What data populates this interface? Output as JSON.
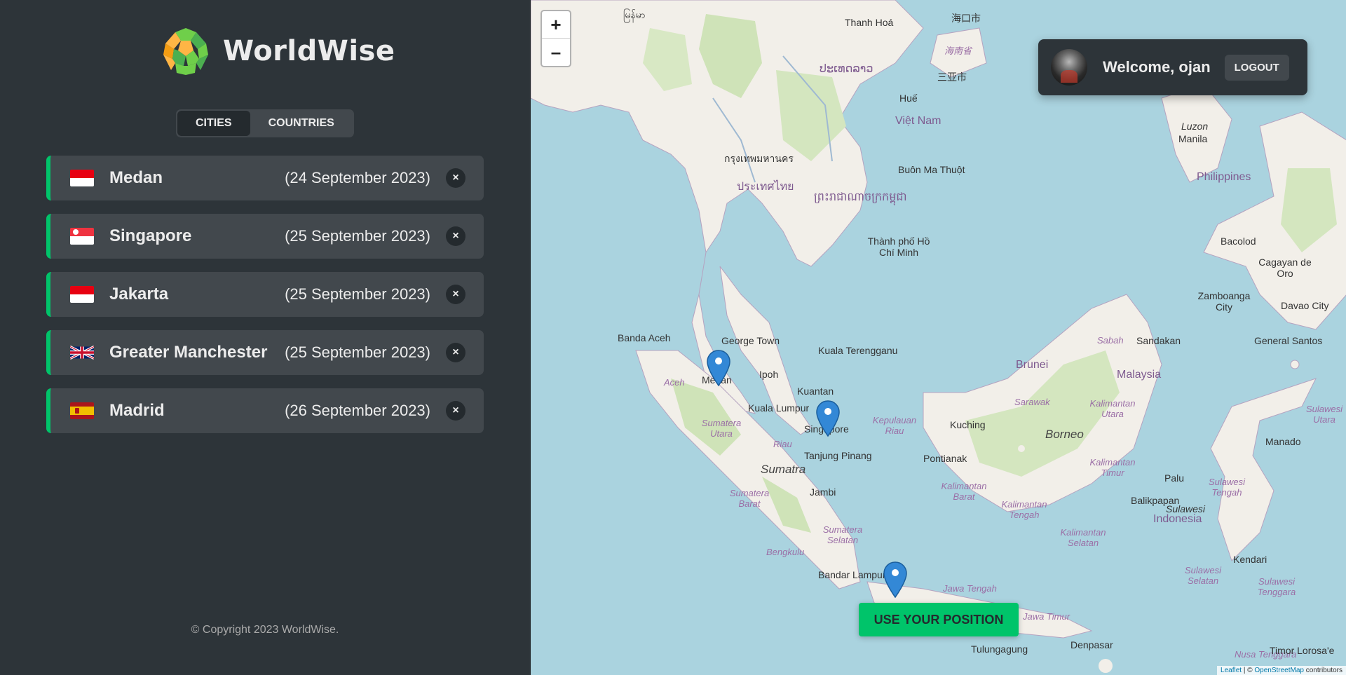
{
  "app": {
    "name": "WorldWise"
  },
  "tabs": [
    {
      "label": "CITIES",
      "active": true
    },
    {
      "label": "COUNTRIES",
      "active": false
    }
  ],
  "cities": [
    {
      "name": "Medan",
      "date": "(24 September 2023)",
      "flag": "indonesia-flag"
    },
    {
      "name": "Singapore",
      "date": "(25 September 2023)",
      "flag": "singapore-flag"
    },
    {
      "name": "Jakarta",
      "date": "(25 September 2023)",
      "flag": "indonesia-flag"
    },
    {
      "name": "Greater Manchester",
      "date": "(25 September 2023)",
      "flag": "uk-flag"
    },
    {
      "name": "Madrid",
      "date": "(26 September 2023)",
      "flag": "spain-flag"
    }
  ],
  "delete_symbol": "×",
  "footer": {
    "copyright": "© Copyright 2023 WorldWise."
  },
  "map": {
    "zoom_in": "+",
    "zoom_out": "–",
    "labels": {
      "myanmar": "မြန်မာ",
      "thanh_hoa": "Thanh Hoá",
      "haikou": "海口市",
      "hainan": "海南省",
      "sanya": "三亚市",
      "laos": "ປະເທດລາວ",
      "hue": "Huế",
      "viet_nam": "Việt Nam",
      "bangkok": "กรุงเทพมหานคร",
      "thailand": "ประเทศไทย",
      "cambodia": "ព្រះរាជាណាចក្រកម្ពុជា",
      "buon_ma_thuot": "Buôn Ma Thuột",
      "hcm": "Thành phố Hồ Chí Minh",
      "luzon": "Luzon",
      "manila": "Manila",
      "philippines": "Philippines",
      "bacolod": "Bacolod",
      "cagayan": "Cagayan de Oro",
      "zamboanga": "Zamboanga City",
      "davao": "Davao City",
      "banda_aceh": "Banda Aceh",
      "george_town": "George Town",
      "kuala_terengganu": "Kuala Terengganu",
      "ipoh": "Ipoh",
      "medan": "Medan",
      "aceh": "Aceh",
      "kuantan": "Kuantan",
      "kuala_lumpur": "Kuala Lumpur",
      "singapore": "Singapore",
      "sumatera_utara": "Sumatera Utara",
      "riau": "Riau",
      "kepulauan_riau": "Kepulauan Riau",
      "tanjung_pinang": "Tanjung Pinang",
      "sumatra": "Sumatra",
      "jambi": "Jambi",
      "sumatera_barat": "Sumatera Barat",
      "sumatera_selatan": "Sumatera Selatan",
      "bengkulu": "Bengkulu",
      "bandar_lampung": "Bandar Lampung",
      "jawa_tengah": "Jawa Tengah",
      "jawa_timur": "Jawa Timur",
      "denpasar": "Denpasar",
      "tulungagung": "Tulungagung",
      "brunei": "Brunei",
      "malaysia": "Malaysia",
      "sabah": "Sabah",
      "sandakan": "Sandakan",
      "general_santos": "General Santos",
      "sarawak": "Sarawak",
      "kuching": "Kuching",
      "borneo": "Borneo",
      "pontianak": "Pontianak",
      "kalimantan_barat": "Kalimantan Barat",
      "kalimantan_utara": "Kalimantan Utara",
      "kalimantan_timur": "Kalimantan Timur",
      "kalimantan_tengah": "Kalimantan Tengah",
      "kalimantan_selatan": "Kalimantan Selatan",
      "balikpapan": "Balikpapan",
      "palu": "Palu",
      "sulawesi_tengah": "Sulawesi Tengah",
      "sulawesi": "Sulawesi",
      "indonesia": "Indonesia",
      "sulawesi_utara": "Sulawesi Utara",
      "manado": "Manado",
      "kendari": "Kendari",
      "sulawesi_tenggara": "Sulawesi Tenggara",
      "sulawesi_selatan": "Sulawesi Selatan",
      "nusa_tenggara": "Nusa Tenggara",
      "timor": "Timor Lorosa'e"
    },
    "attribution_leaflet": "Leaflet",
    "attribution_sep": " | © ",
    "attribution_osm": "OpenStreetMap",
    "attribution_rest": " contributors"
  },
  "user": {
    "welcome": "Welcome, ojan",
    "logout_label": "LOGOUT"
  },
  "position_button": "USE YOUR POSITION",
  "colors": {
    "accent": "#00c46a",
    "panel": "#2d3439",
    "item": "#42484d",
    "dark": "#242a2e"
  }
}
